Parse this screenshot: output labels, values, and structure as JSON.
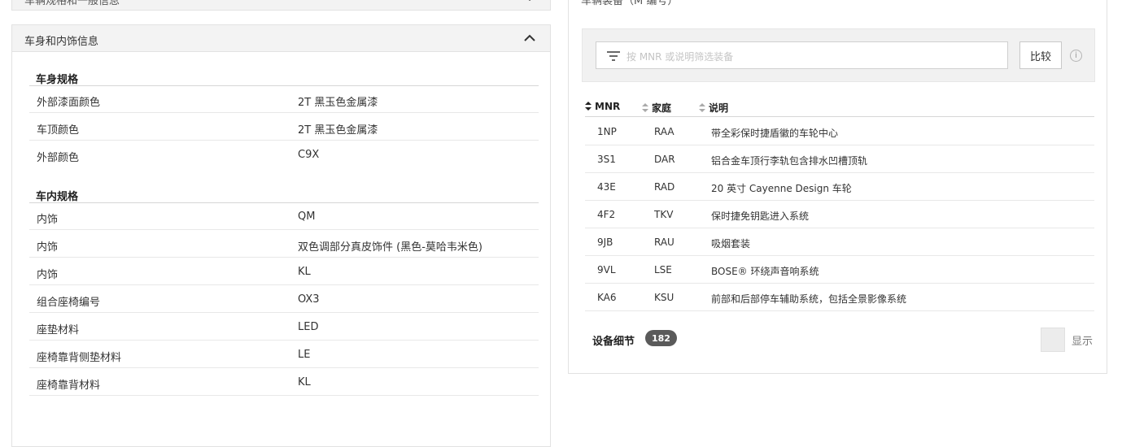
{
  "left": {
    "collapsed_title": "车辆规格和一般信息",
    "section_title": "车身和内饰信息",
    "groups": [
      {
        "title": "车身规格",
        "rows": [
          {
            "k": "外部漆面颜色",
            "v": "2T 黑玉色金属漆"
          },
          {
            "k": "车顶颜色",
            "v": "2T 黑玉色金属漆"
          },
          {
            "k": "外部颜色",
            "v": "C9X"
          }
        ]
      },
      {
        "title": "车内规格",
        "rows": [
          {
            "k": "内饰",
            "v": "QM"
          },
          {
            "k": "内饰",
            "v": "双色调部分真皮饰件 (黑色-莫哈韦米色)"
          },
          {
            "k": "内饰",
            "v": "KL"
          },
          {
            "k": "组合座椅编号",
            "v": "OX3"
          },
          {
            "k": "座垫材料",
            "v": "LED"
          },
          {
            "k": "座椅靠背侧垫材料",
            "v": "LE"
          },
          {
            "k": "座椅靠背材料",
            "v": "KL"
          }
        ]
      }
    ]
  },
  "right": {
    "collapsed_title": "车辆装备（M 编号）",
    "search_placeholder": "按 MNR 或说明筛选装备",
    "compare_label": "比较",
    "info_glyph": "i",
    "columns": [
      "MNR",
      "家庭",
      "说明"
    ],
    "rows": [
      {
        "mnr": "1NP",
        "family": "RAA",
        "desc": "带全彩保时捷盾徽的车轮中心"
      },
      {
        "mnr": "3S1",
        "family": "DAR",
        "desc": "铝合金车顶行李轨包含排水凹槽顶轨"
      },
      {
        "mnr": "43E",
        "family": "RAD",
        "desc": "20 英寸 Cayenne Design 车轮"
      },
      {
        "mnr": "4F2",
        "family": "TKV",
        "desc": "保时捷免钥匙进入系统"
      },
      {
        "mnr": "9JB",
        "family": "RAU",
        "desc": "吸烟套装"
      },
      {
        "mnr": "9VL",
        "family": "LSE",
        "desc": "BOSE® 环绕声音响系统"
      },
      {
        "mnr": "KA6",
        "family": "KSU",
        "desc": "前部和后部停车辅助系统，包括全景影像系统"
      }
    ],
    "footer_label": "设备细节",
    "count": "182",
    "show_label": "显示"
  },
  "icons": {
    "collapse": "chevron-up-icon",
    "filter": "filter-icon",
    "sort": "sort-icon",
    "info": "info-icon"
  }
}
